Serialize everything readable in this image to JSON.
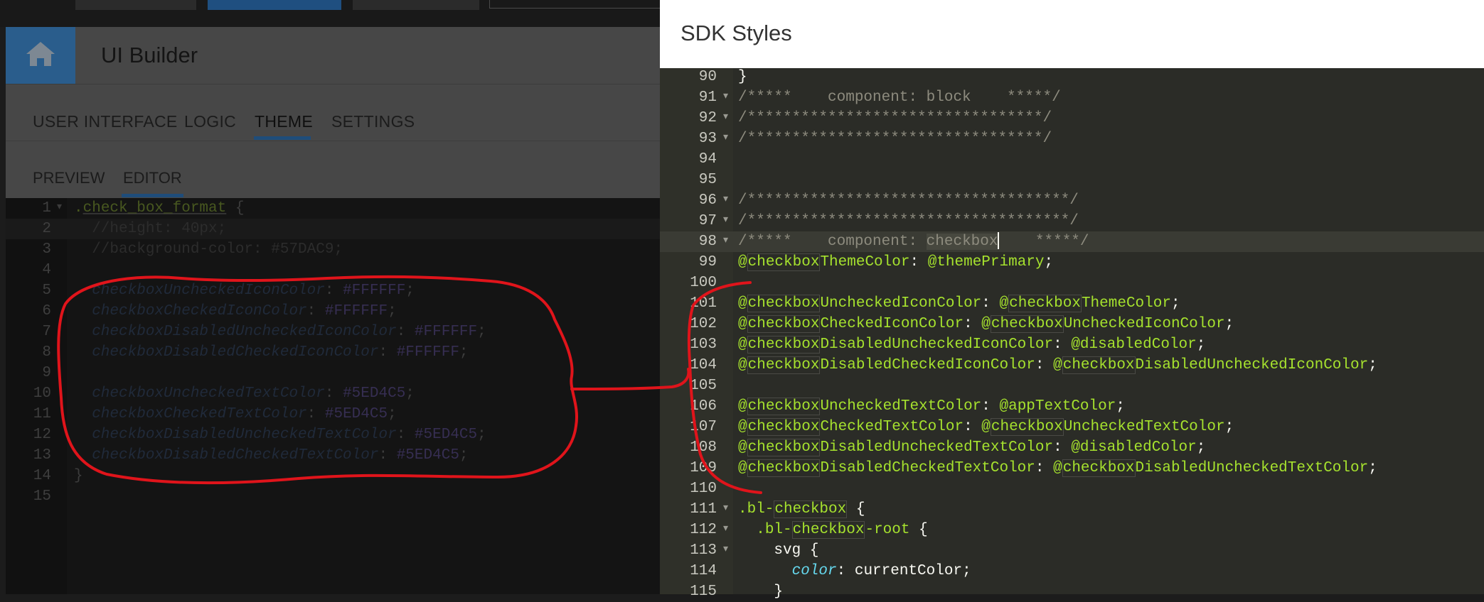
{
  "app": {
    "title": "UI Builder"
  },
  "main_tabs": [
    "USER INTERFACE",
    "LOGIC",
    "THEME",
    "SETTINGS"
  ],
  "sub_tabs": [
    "PREVIEW",
    "EDITOR"
  ],
  "left_editor": {
    "lines": [
      {
        "n": "1",
        "fold": true,
        "segs": [
          [
            "sel",
            "."
          ],
          [
            "selname",
            "check_box_format"
          ],
          [
            "punc",
            " {"
          ]
        ]
      },
      {
        "n": "2",
        "fold": false,
        "segs": [
          [
            "cmt",
            "  //height: 40px;"
          ]
        ]
      },
      {
        "n": "3",
        "fold": false,
        "segs": [
          [
            "cmt",
            "  //background-color: #57DAC9;"
          ]
        ]
      },
      {
        "n": "4",
        "fold": false,
        "segs": []
      },
      {
        "n": "5",
        "fold": false,
        "segs": [
          [
            "prop",
            "  checkboxUncheckedIconColor"
          ],
          [
            "punc",
            ": "
          ],
          [
            "val",
            "#FFFFFF"
          ],
          [
            "punc",
            ";"
          ]
        ]
      },
      {
        "n": "6",
        "fold": false,
        "segs": [
          [
            "prop",
            "  checkboxCheckedIconColor"
          ],
          [
            "punc",
            ": "
          ],
          [
            "val",
            "#FFFFFF"
          ],
          [
            "punc",
            ";"
          ]
        ]
      },
      {
        "n": "7",
        "fold": false,
        "segs": [
          [
            "prop",
            "  checkboxDisabledUncheckedIconColor"
          ],
          [
            "punc",
            ": "
          ],
          [
            "val",
            "#FFFFFF"
          ],
          [
            "punc",
            ";"
          ]
        ]
      },
      {
        "n": "8",
        "fold": false,
        "segs": [
          [
            "prop",
            "  checkboxDisabledCheckedIconColor"
          ],
          [
            "punc",
            ": "
          ],
          [
            "val",
            "#FFFFFF"
          ],
          [
            "punc",
            ";"
          ]
        ]
      },
      {
        "n": "9",
        "fold": false,
        "segs": []
      },
      {
        "n": "10",
        "fold": false,
        "segs": [
          [
            "prop",
            "  checkboxUncheckedTextColor"
          ],
          [
            "punc",
            ": "
          ],
          [
            "val",
            "#5ED4C5"
          ],
          [
            "punc",
            ";"
          ]
        ]
      },
      {
        "n": "11",
        "fold": false,
        "segs": [
          [
            "prop",
            "  checkboxCheckedTextColor"
          ],
          [
            "punc",
            ": "
          ],
          [
            "val",
            "#5ED4C5"
          ],
          [
            "punc",
            ";"
          ]
        ]
      },
      {
        "n": "12",
        "fold": false,
        "segs": [
          [
            "prop",
            "  checkboxDisabledUncheckedTextColor"
          ],
          [
            "punc",
            ": "
          ],
          [
            "val",
            "#5ED4C5"
          ],
          [
            "punc",
            ";"
          ]
        ]
      },
      {
        "n": "13",
        "fold": false,
        "segs": [
          [
            "prop",
            "  checkboxDisabledCheckedTextColor"
          ],
          [
            "punc",
            ": "
          ],
          [
            "val",
            "#5ED4C5"
          ],
          [
            "punc",
            ";"
          ]
        ]
      },
      {
        "n": "14",
        "fold": false,
        "segs": [
          [
            "punc",
            "}"
          ]
        ]
      },
      {
        "n": "15",
        "fold": false,
        "segs": []
      }
    ]
  },
  "panel": {
    "title": "SDK Styles",
    "lines": [
      {
        "n": "90",
        "fold": false,
        "segs": [
          [
            "p",
            "}"
          ]
        ]
      },
      {
        "n": "91",
        "fold": true,
        "segs": [
          [
            "c",
            "/*****    component: block    *****/"
          ]
        ]
      },
      {
        "n": "92",
        "fold": true,
        "segs": [
          [
            "c",
            "/*********************************/"
          ]
        ]
      },
      {
        "n": "93",
        "fold": true,
        "segs": [
          [
            "c",
            "/*********************************/"
          ]
        ]
      },
      {
        "n": "94",
        "fold": false,
        "segs": []
      },
      {
        "n": "95",
        "fold": false,
        "segs": []
      },
      {
        "n": "96",
        "fold": true,
        "segs": [
          [
            "c",
            "/************************************/"
          ]
        ]
      },
      {
        "n": "97",
        "fold": true,
        "segs": [
          [
            "c",
            "/************************************/"
          ]
        ]
      },
      {
        "n": "98",
        "fold": true,
        "segs": [
          [
            "c",
            "/*****    component: "
          ],
          [
            "c hlsel",
            "checkbox"
          ],
          [
            "caret",
            ""
          ],
          [
            "c",
            "    *****/"
          ]
        ]
      },
      {
        "n": "99",
        "fold": false,
        "segs": [
          [
            "v",
            "@"
          ],
          [
            "v hl",
            "checkbox"
          ],
          [
            "v",
            "ThemeColor"
          ],
          [
            "p",
            ": "
          ],
          [
            "v",
            "@themePrimary"
          ],
          [
            "p",
            ";"
          ]
        ]
      },
      {
        "n": "100",
        "fold": false,
        "segs": []
      },
      {
        "n": "101",
        "fold": false,
        "segs": [
          [
            "v",
            "@"
          ],
          [
            "v hl",
            "checkbox"
          ],
          [
            "v",
            "UncheckedIconColor"
          ],
          [
            "p",
            ": "
          ],
          [
            "v",
            "@"
          ],
          [
            "v hl",
            "checkbox"
          ],
          [
            "v",
            "ThemeColor"
          ],
          [
            "p",
            ";"
          ]
        ]
      },
      {
        "n": "102",
        "fold": false,
        "segs": [
          [
            "v",
            "@"
          ],
          [
            "v hl",
            "checkbox"
          ],
          [
            "v",
            "CheckedIconColor"
          ],
          [
            "p",
            ": "
          ],
          [
            "v",
            "@"
          ],
          [
            "v hl",
            "checkbox"
          ],
          [
            "v",
            "UncheckedIconColor"
          ],
          [
            "p",
            ";"
          ]
        ]
      },
      {
        "n": "103",
        "fold": false,
        "segs": [
          [
            "v",
            "@"
          ],
          [
            "v hl",
            "checkbox"
          ],
          [
            "v",
            "DisabledUncheckedIconColor"
          ],
          [
            "p",
            ": "
          ],
          [
            "v",
            "@disabledColor"
          ],
          [
            "p",
            ";"
          ]
        ]
      },
      {
        "n": "104",
        "fold": false,
        "segs": [
          [
            "v",
            "@"
          ],
          [
            "v hl",
            "checkbox"
          ],
          [
            "v",
            "DisabledCheckedIconColor"
          ],
          [
            "p",
            ": "
          ],
          [
            "v",
            "@"
          ],
          [
            "v hl",
            "checkbox"
          ],
          [
            "v",
            "DisabledUncheckedIconColor"
          ],
          [
            "p",
            ";"
          ]
        ]
      },
      {
        "n": "105",
        "fold": false,
        "segs": []
      },
      {
        "n": "106",
        "fold": false,
        "segs": [
          [
            "v",
            "@"
          ],
          [
            "v hl",
            "checkbox"
          ],
          [
            "v",
            "UncheckedTextColor"
          ],
          [
            "p",
            ": "
          ],
          [
            "v",
            "@appTextColor"
          ],
          [
            "p",
            ";"
          ]
        ]
      },
      {
        "n": "107",
        "fold": false,
        "segs": [
          [
            "v",
            "@"
          ],
          [
            "v hl",
            "checkbox"
          ],
          [
            "v",
            "CheckedTextColor"
          ],
          [
            "p",
            ": "
          ],
          [
            "v",
            "@"
          ],
          [
            "v hl",
            "checkbox"
          ],
          [
            "v",
            "UncheckedTextColor"
          ],
          [
            "p",
            ";"
          ]
        ]
      },
      {
        "n": "108",
        "fold": false,
        "segs": [
          [
            "v",
            "@"
          ],
          [
            "v hl",
            "checkbox"
          ],
          [
            "v",
            "DisabledUncheckedTextColor"
          ],
          [
            "p",
            ": "
          ],
          [
            "v",
            "@disabledColor"
          ],
          [
            "p",
            ";"
          ]
        ]
      },
      {
        "n": "109",
        "fold": false,
        "segs": [
          [
            "v",
            "@"
          ],
          [
            "v hl",
            "checkbox"
          ],
          [
            "v",
            "DisabledCheckedTextColor"
          ],
          [
            "p",
            ": "
          ],
          [
            "v",
            "@"
          ],
          [
            "v hl",
            "checkbox"
          ],
          [
            "v",
            "DisabledUncheckedTextColor"
          ],
          [
            "p",
            ";"
          ]
        ]
      },
      {
        "n": "110",
        "fold": false,
        "segs": []
      },
      {
        "n": "111",
        "fold": true,
        "segs": [
          [
            "v",
            ".bl-"
          ],
          [
            "v hl",
            "checkbox"
          ],
          [
            "p",
            " {"
          ]
        ]
      },
      {
        "n": "112",
        "fold": true,
        "segs": [
          [
            "p",
            "  "
          ],
          [
            "v",
            ".bl-"
          ],
          [
            "v hl",
            "checkbox"
          ],
          [
            "v",
            "-root"
          ],
          [
            "p",
            " {"
          ]
        ]
      },
      {
        "n": "113",
        "fold": true,
        "segs": [
          [
            "p",
            "    svg {"
          ]
        ]
      },
      {
        "n": "114",
        "fold": false,
        "segs": [
          [
            "p",
            "      "
          ],
          [
            "i",
            "color"
          ],
          [
            "p",
            ": currentColor;"
          ]
        ]
      },
      {
        "n": "115",
        "fold": false,
        "segs": [
          [
            "p",
            "    }"
          ]
        ]
      }
    ]
  },
  "annotation_color": "#e0141b"
}
